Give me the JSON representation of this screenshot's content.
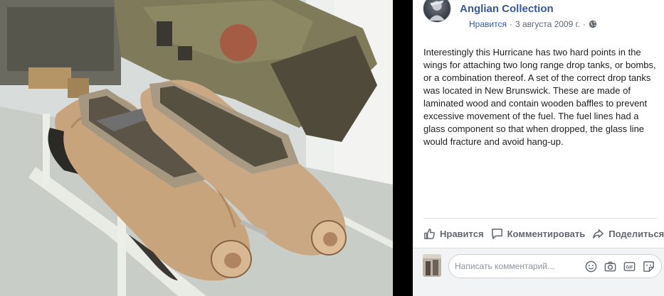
{
  "post": {
    "page_name": "Anglian Collection",
    "like_link": "Нравится",
    "separator": "·",
    "date": "3 августа 2009 г.",
    "date_separator": "·",
    "text": "Interestingly this Hurricane has two hard points in the wings for attaching two long range drop tanks, or bombs, or a combination thereof. A set of the correct drop tanks was located in New Brunswick. These are made of laminated wood and contain wooden baffles to prevent excessive movement of the fuel. The fuel lines had a glass component so that when dropped, the glass line would fracture and avoid hang-up."
  },
  "actions": {
    "like": "Нравится",
    "comment": "Комментировать",
    "share": "Поделиться"
  },
  "comment_box": {
    "placeholder": "Написать комментарий..."
  },
  "icons": {
    "privacy": "globe-icon",
    "like": "thumbs-up-icon",
    "comment": "speech-bubble-icon",
    "share": "share-arrow-icon",
    "emoji": "smiley-icon",
    "camera": "camera-icon",
    "gif": "gif-icon",
    "sticker": "sticker-icon"
  },
  "colors": {
    "link": "#385898",
    "secondary_text": "#606770",
    "body_text": "#1c1e21"
  }
}
